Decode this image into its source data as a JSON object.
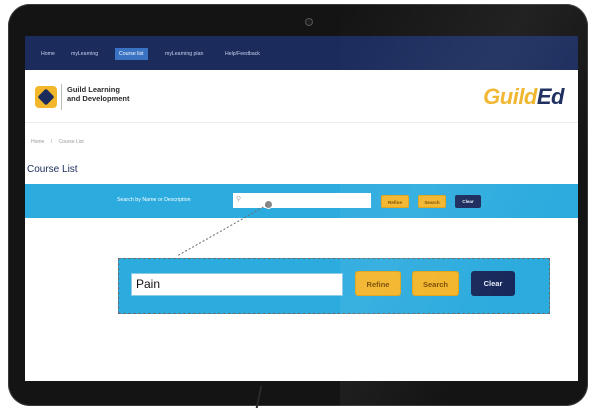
{
  "nav": {
    "items": [
      {
        "label": "Home"
      },
      {
        "label": "myLearning"
      },
      {
        "label": "Course list",
        "active": true
      },
      {
        "label": "myLearning plan"
      },
      {
        "label": "Help/Feedback"
      }
    ]
  },
  "header": {
    "org_line1": "Guild Learning",
    "org_line2": "and Development",
    "brand_part1": "Guild",
    "brand_part2": "Ed"
  },
  "breadcrumb": {
    "home": "Home",
    "separator": "/",
    "current": "Course List"
  },
  "page": {
    "title": "Course List"
  },
  "search": {
    "label": "Search by Name or Description",
    "value": "",
    "refine_label": "Refine",
    "search_label": "Search",
    "clear_label": "Clear"
  },
  "zoom": {
    "value": "Pain",
    "refine_label": "Refine",
    "search_label": "Search",
    "clear_label": "Clear"
  },
  "icons": {
    "search": "search-icon",
    "logo": "guild-logo-icon"
  },
  "colors": {
    "nav_bg": "#1a2b5c",
    "search_bar": "#2cabde",
    "accent_yellow": "#f2b52a",
    "navy_button": "#18285a",
    "brand_yellow": "#f0b429"
  }
}
